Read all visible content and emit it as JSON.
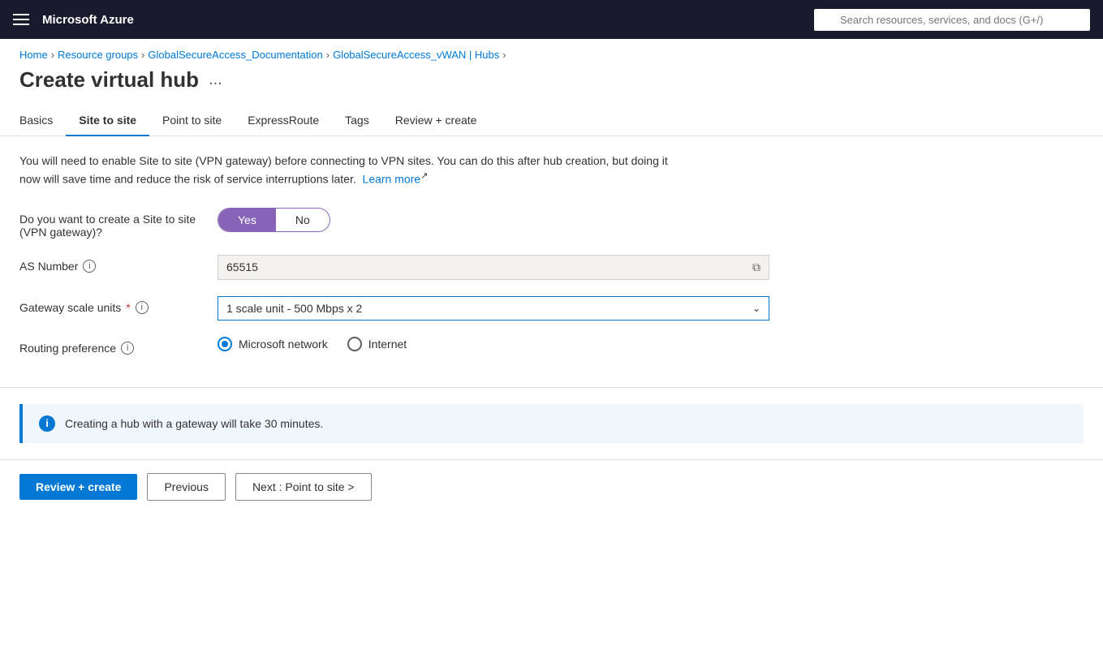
{
  "topbar": {
    "hamburger_label": "Menu",
    "title": "Microsoft Azure",
    "search_placeholder": "Search resources, services, and docs (G+/)"
  },
  "breadcrumb": {
    "items": [
      {
        "label": "Home",
        "href": "#"
      },
      {
        "label": "Resource groups",
        "href": "#"
      },
      {
        "label": "GlobalSecureAccess_Documentation",
        "href": "#"
      },
      {
        "label": "GlobalSecureAccess_vWAN | Hubs",
        "href": "#"
      }
    ]
  },
  "page": {
    "title": "Create virtual hub",
    "dots_label": "..."
  },
  "tabs": [
    {
      "id": "basics",
      "label": "Basics",
      "active": false
    },
    {
      "id": "site-to-site",
      "label": "Site to site",
      "active": true
    },
    {
      "id": "point-to-site",
      "label": "Point to site",
      "active": false
    },
    {
      "id": "expressroute",
      "label": "ExpressRoute",
      "active": false
    },
    {
      "id": "tags",
      "label": "Tags",
      "active": false
    },
    {
      "id": "review-create",
      "label": "Review + create",
      "active": false
    }
  ],
  "info_text": "You will need to enable Site to site (VPN gateway) before connecting to VPN sites. You can do this after hub creation, but doing it now will save time and reduce the risk of service interruptions later.",
  "learn_more_label": "Learn more",
  "form": {
    "vpn_gateway_label": "Do you want to create a Site to site (VPN gateway)?",
    "yes_label": "Yes",
    "no_label": "No",
    "as_number_label": "AS Number",
    "as_number_value": "65515",
    "gateway_scale_label": "Gateway scale units",
    "gateway_scale_required": true,
    "gateway_scale_value": "1 scale unit - 500 Mbps x 2",
    "routing_pref_label": "Routing preference",
    "routing_options": [
      {
        "label": "Microsoft network",
        "selected": true
      },
      {
        "label": "Internet",
        "selected": false
      }
    ]
  },
  "info_banner": {
    "text": "Creating a hub with a gateway will take 30 minutes."
  },
  "buttons": {
    "review_create": "Review + create",
    "previous": "Previous",
    "next": "Next : Point to site >"
  }
}
